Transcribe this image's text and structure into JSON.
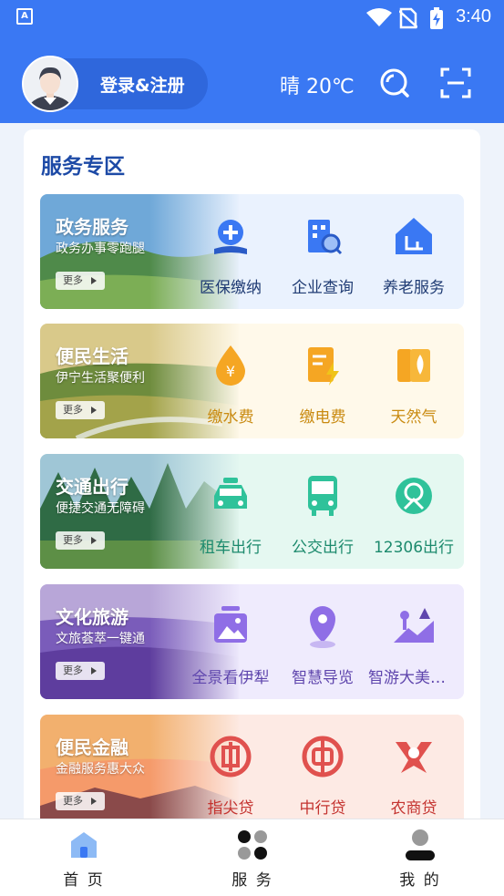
{
  "status_bar": {
    "time": "3:40",
    "app_badge": "A"
  },
  "header": {
    "login_label": "登录&注册",
    "weather": "晴 20℃"
  },
  "main": {
    "title": "服务专区",
    "sections": [
      {
        "name": "政务服务",
        "subtitle": "政务办事零跑腿",
        "more": "更多",
        "items": [
          {
            "label": "医保缴纳",
            "icon": "medical-insurance-icon"
          },
          {
            "label": "企业查询",
            "icon": "enterprise-search-icon"
          },
          {
            "label": "养老服务",
            "icon": "elderly-care-icon"
          }
        ],
        "colors": {
          "accent": "#3a78f3",
          "bg": "#eaf2fe",
          "label": "#1f3b73"
        }
      },
      {
        "name": "便民生活",
        "subtitle": "伊宁生活聚便利",
        "more": "更多",
        "items": [
          {
            "label": "缴水费",
            "icon": "water-bill-icon"
          },
          {
            "label": "缴电费",
            "icon": "electricity-bill-icon"
          },
          {
            "label": "天然气",
            "icon": "gas-icon"
          }
        ],
        "colors": {
          "accent": "#f5a623",
          "bg": "#fff9ea",
          "label": "#c98a10"
        }
      },
      {
        "name": "交通出行",
        "subtitle": "便捷交通无障碍",
        "more": "更多",
        "items": [
          {
            "label": "租车出行",
            "icon": "taxi-icon"
          },
          {
            "label": "公交出行",
            "icon": "bus-icon"
          },
          {
            "label": "12306出行",
            "icon": "railway-icon"
          }
        ],
        "colors": {
          "accent": "#2fc29a",
          "bg": "#e5f8f1",
          "label": "#1c8a6d"
        }
      },
      {
        "name": "文化旅游",
        "subtitle": "文旅荟萃一键通",
        "more": "更多",
        "items": [
          {
            "label": "全景看伊犁",
            "icon": "panorama-icon"
          },
          {
            "label": "智慧导览",
            "icon": "location-guide-icon"
          },
          {
            "label": "智游大美伊犁",
            "icon": "scenic-tour-icon"
          }
        ],
        "colors": {
          "accent": "#8f6ee6",
          "bg": "#efebfd",
          "label": "#5f46ad"
        }
      },
      {
        "name": "便民金融",
        "subtitle": "金融服务惠大众",
        "more": "更多",
        "items": [
          {
            "label": "指尖贷",
            "icon": "icbc-loan-icon"
          },
          {
            "label": "中行贷",
            "icon": "boc-loan-icon"
          },
          {
            "label": "农商贷",
            "icon": "rural-bank-loan-icon"
          }
        ],
        "colors": {
          "accent": "#e0514e",
          "bg": "#fdeae4",
          "label": "#c4332f"
        }
      }
    ]
  },
  "nav": {
    "tabs": [
      {
        "label": "首 页",
        "icon": "home-icon"
      },
      {
        "label": "服 务",
        "icon": "services-grid-icon"
      },
      {
        "label": "我 的",
        "icon": "profile-icon"
      }
    ]
  }
}
